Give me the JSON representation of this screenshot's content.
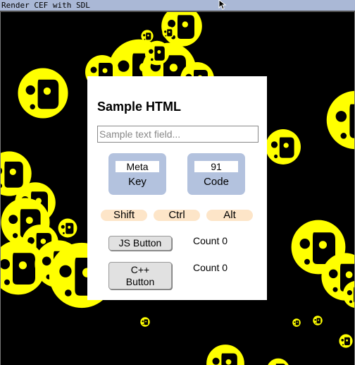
{
  "window": {
    "title": "Render CEF with SDL"
  },
  "page": {
    "heading": "Sample HTML",
    "text_field": {
      "placeholder": "Sample text field...",
      "value": ""
    },
    "key_display": {
      "value": "Meta",
      "label": "Key"
    },
    "code_display": {
      "value": "91",
      "label": "Code"
    },
    "modifiers": [
      {
        "label": "Shift"
      },
      {
        "label": "Ctrl"
      },
      {
        "label": "Alt"
      }
    ],
    "js_button": {
      "label": "JS Button",
      "count_text": "Count 0"
    },
    "cpp_button": {
      "label_line1": "C++",
      "label_line2": "Button",
      "count_text": "Count 0"
    }
  },
  "colors": {
    "smiley": "#ffff00",
    "title_bar": "#aab8d6",
    "key_box": "#b3c2de",
    "modifier_pill": "#fde5c8"
  },
  "icons": {
    "background_sprite": "smiley-icon",
    "cursor": "mouse-cursor-icon"
  }
}
